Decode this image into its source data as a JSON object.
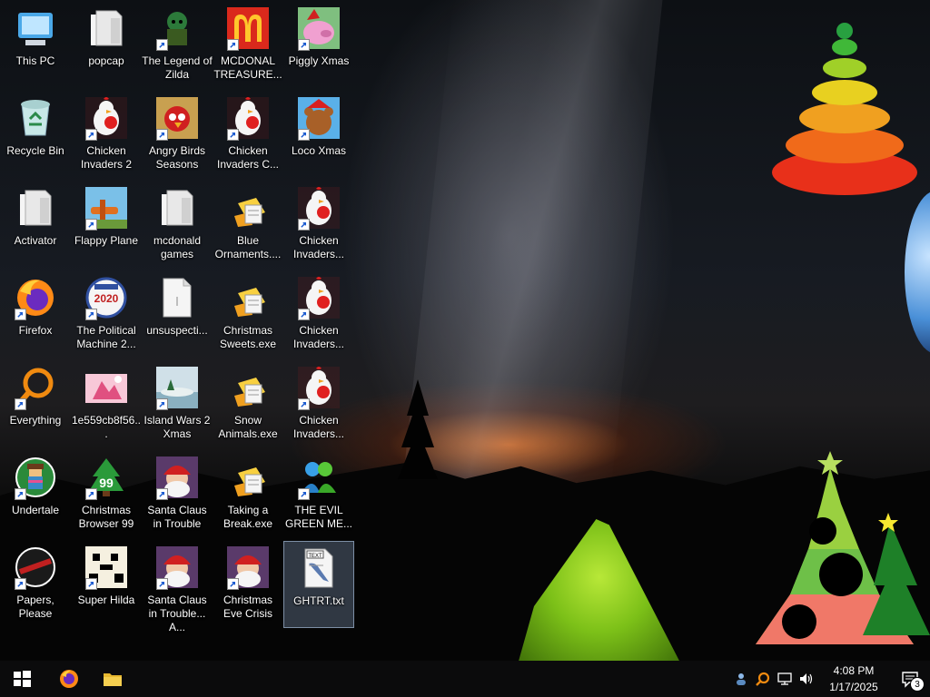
{
  "desktop": {
    "wallpaper": "night-sky-milky-way-camping-tent",
    "icons": [
      {
        "label": "This PC",
        "icon": "computer-icon",
        "shortcut": false
      },
      {
        "label": "popcap",
        "icon": "folder-icon",
        "shortcut": false
      },
      {
        "label": "The Legend of Zilda",
        "icon": "game-icon",
        "shortcut": true
      },
      {
        "label": "MCDONAL TREASURE...",
        "icon": "mcdonalds-icon",
        "shortcut": true
      },
      {
        "label": "Piggly Xmas",
        "icon": "pig-icon",
        "shortcut": true
      },
      {
        "label": "Recycle Bin",
        "icon": "recycle-bin-icon",
        "shortcut": false
      },
      {
        "label": "Chicken Invaders 2",
        "icon": "chicken-icon",
        "shortcut": true
      },
      {
        "label": "Angry Birds Seasons",
        "icon": "angry-birds-icon",
        "shortcut": true
      },
      {
        "label": "Chicken Invaders C...",
        "icon": "chicken-icon",
        "shortcut": true
      },
      {
        "label": "Loco Xmas",
        "icon": "bear-icon",
        "shortcut": true
      },
      {
        "label": "Activator",
        "icon": "folder-icon",
        "shortcut": false
      },
      {
        "label": "Flappy Plane",
        "icon": "plane-icon",
        "shortcut": true
      },
      {
        "label": "mcdonald games",
        "icon": "folder-icon",
        "shortcut": false
      },
      {
        "label": "Blue Ornaments....",
        "icon": "installer-icon",
        "shortcut": false
      },
      {
        "label": "Chicken Invaders...",
        "icon": "chicken-icon",
        "shortcut": true
      },
      {
        "label": "Firefox",
        "icon": "firefox-icon",
        "shortcut": true
      },
      {
        "label": "The Political Machine 2...",
        "icon": "political-machine-icon",
        "shortcut": true
      },
      {
        "label": "unsuspecti...",
        "icon": "file-icon",
        "shortcut": false
      },
      {
        "label": "Christmas Sweets.exe",
        "icon": "installer-icon",
        "shortcut": false
      },
      {
        "label": "Chicken Invaders...",
        "icon": "chicken-icon",
        "shortcut": true
      },
      {
        "label": "Everything",
        "icon": "everything-search-icon",
        "shortcut": true
      },
      {
        "label": "1e559cb8f56...",
        "icon": "image-icon",
        "shortcut": false
      },
      {
        "label": "Island Wars 2 Xmas",
        "icon": "island-icon",
        "shortcut": true
      },
      {
        "label": "Snow Animals.exe",
        "icon": "installer-icon",
        "shortcut": false
      },
      {
        "label": "Chicken Invaders...",
        "icon": "chicken-icon",
        "shortcut": true
      },
      {
        "label": "Undertale",
        "icon": "undertale-icon",
        "shortcut": true
      },
      {
        "label": "Christmas Browser 99",
        "icon": "christmas-tree-icon",
        "shortcut": true
      },
      {
        "label": "Santa Claus in Trouble",
        "icon": "santa-icon",
        "shortcut": true
      },
      {
        "label": "Taking a Break.exe",
        "icon": "installer-icon",
        "shortcut": false
      },
      {
        "label": "THE EVIL GREEN ME...",
        "icon": "messenger-icon",
        "shortcut": true
      },
      {
        "label": "Papers, Please",
        "icon": "papers-please-icon",
        "shortcut": true
      },
      {
        "label": "Super Hilda",
        "icon": "pixel-icon",
        "shortcut": true
      },
      {
        "label": "Santa Claus in Trouble... A...",
        "icon": "santa-icon",
        "shortcut": true
      },
      {
        "label": "Christmas Eve Crisis",
        "icon": "santa-icon",
        "shortcut": true
      },
      {
        "label": "GHTRT.txt",
        "icon": "text-file-icon",
        "shortcut": false,
        "selected": true
      }
    ]
  },
  "taskbar": {
    "start_label": "Start",
    "pinned": [
      {
        "name": "firefox-icon"
      },
      {
        "name": "file-explorer-icon"
      }
    ],
    "tray": {
      "icons": [
        "people-icon",
        "everything-search-icon",
        "network-icon",
        "volume-icon"
      ],
      "time": "4:08 PM",
      "date": "1/17/2025",
      "notifications_count": "3"
    }
  },
  "colors": {
    "taskbar_bg": "#0b0b0c",
    "selection": "#a0bee6"
  }
}
